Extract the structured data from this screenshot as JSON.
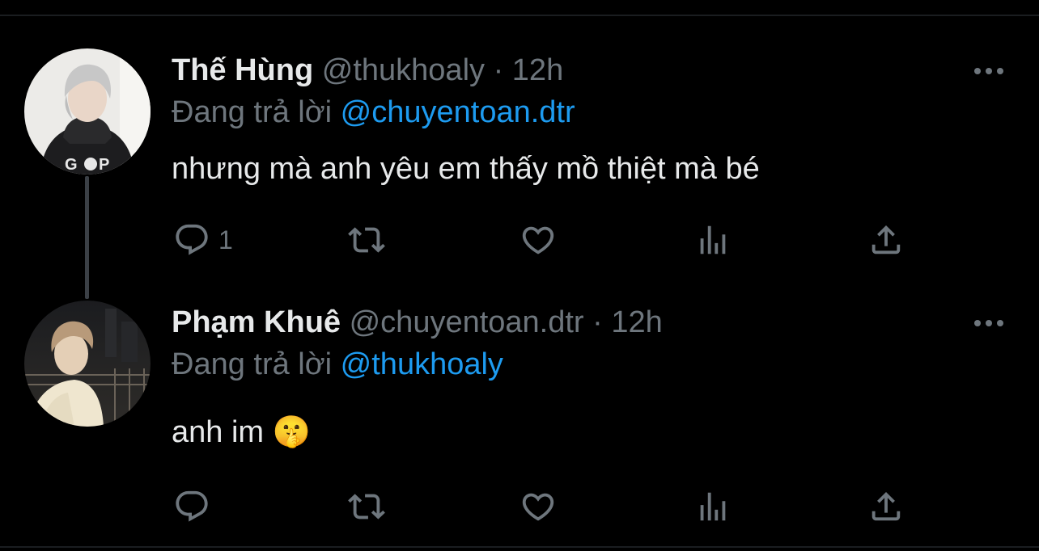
{
  "tweets": [
    {
      "display_name": "Thế Hùng",
      "handle": "@thukhoaly",
      "separator": "·",
      "time": "12h",
      "replying_prefix": "Đang trả lời",
      "replying_to": "@chuyentoan.dtr",
      "text": "nhưng mà anh yêu em thấy mồ thiệt mà bé",
      "reply_count": "1"
    },
    {
      "display_name": "Phạm Khuê",
      "handle": "@chuyentoan.dtr",
      "separator": "·",
      "time": "12h",
      "replying_prefix": "Đang trả lời",
      "replying_to": "@thukhoaly",
      "text": "anh im 🤫",
      "reply_count": ""
    }
  ],
  "icons": {
    "reply": "reply-icon",
    "retweet": "retweet-icon",
    "like": "heart-icon",
    "views": "analytics-icon",
    "share": "share-icon",
    "more": "more-icon"
  },
  "colors": {
    "background": "#000000",
    "text": "#e7e9ea",
    "muted": "#6e767d",
    "accent": "#1d9bf0"
  }
}
